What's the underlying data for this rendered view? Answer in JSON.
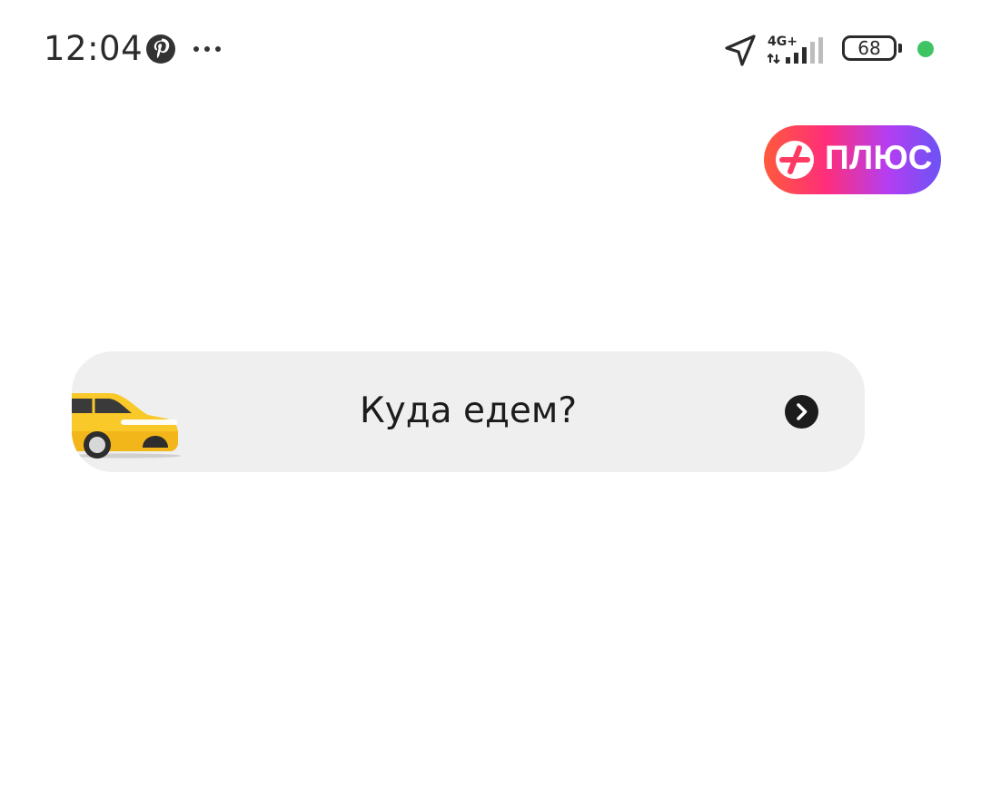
{
  "status_bar": {
    "time": "12:04",
    "network": "4G+",
    "battery_level": "68",
    "icons": [
      "pinterest-icon",
      "more-dots-icon",
      "location-arrow-icon",
      "signal-icon",
      "battery-icon",
      "mic-indicator-dot"
    ]
  },
  "plus_badge": {
    "label": "ПЛЮС",
    "gradient_colors": [
      "#ff5a3c",
      "#ff2e7a",
      "#b43ef2",
      "#6b53f5"
    ]
  },
  "where_card": {
    "label": "Куда едем?",
    "icon_left": "taxi-car-icon",
    "icon_right": "chevron-right-circle-icon",
    "background": "#efefef"
  }
}
